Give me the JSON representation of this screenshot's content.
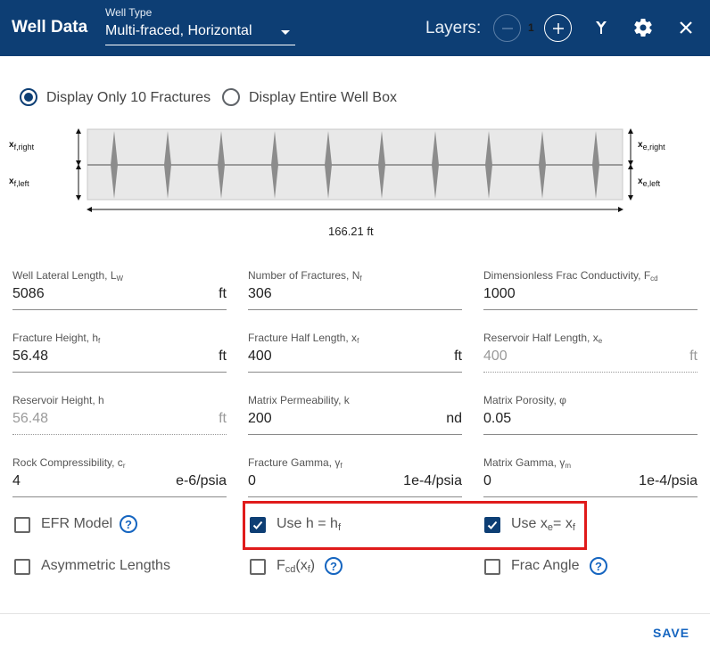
{
  "header": {
    "title": "Well Data",
    "well_type_label": "Well Type",
    "well_type_value": "Multi-fraced, Horizontal",
    "layers_label": "Layers:",
    "layers_count": "1"
  },
  "display_options": {
    "option_10": "Display Only 10 Fractures",
    "option_entire": "Display Entire Well Box",
    "selected": "option_10"
  },
  "diagram": {
    "fracture_count_shown": 10,
    "left_top_main": "x",
    "left_top_sub": "f,right",
    "left_bottom_main": "x",
    "left_bottom_sub": "f,left",
    "right_top_main": "x",
    "right_top_sub": "e,right",
    "right_bottom_main": "x",
    "right_bottom_sub": "e,left",
    "width_label": "166.21 ft"
  },
  "fields": {
    "lateral_length": {
      "label": "Well Lateral Length, L",
      "label_sub": "W",
      "value": "5086",
      "unit": "ft"
    },
    "num_fractures": {
      "label": "Number of Fractures, N",
      "label_sub": "f",
      "value": "306",
      "unit": ""
    },
    "frac_conductivity": {
      "label": "Dimensionless Frac Conductivity, F",
      "label_sub": "cd",
      "value": "1000",
      "unit": ""
    },
    "fracture_height": {
      "label": "Fracture Height, h",
      "label_sub": "f",
      "value": "56.48",
      "unit": "ft"
    },
    "fracture_half_length": {
      "label": "Fracture Half Length, x",
      "label_sub": "f",
      "value": "400",
      "unit": "ft"
    },
    "reservoir_half_length": {
      "label": "Reservoir Half Length, x",
      "label_sub": "e",
      "value": "400",
      "unit": "ft"
    },
    "reservoir_height": {
      "label": "Reservoir Height, h",
      "label_sub": "",
      "value": "56.48",
      "unit": "ft"
    },
    "matrix_permeability": {
      "label": "Matrix Permeability, k",
      "label_sub": "",
      "value": "200",
      "unit": "nd"
    },
    "matrix_porosity": {
      "label": "Matrix Porosity, φ",
      "label_sub": "",
      "value": "0.05",
      "unit": ""
    },
    "rock_compressibility": {
      "label": "Rock Compressibility, c",
      "label_sub": "r",
      "value": "4",
      "unit": "e-6/psia"
    },
    "fracture_gamma": {
      "label": "Fracture Gamma, γ",
      "label_sub": "f",
      "value": "0",
      "unit": "1e-4/psia"
    },
    "matrix_gamma": {
      "label": "Matrix Gamma, γ",
      "label_sub": "m",
      "value": "0",
      "unit": "1e-4/psia"
    }
  },
  "checkboxes": {
    "efr_model": {
      "label": "EFR Model",
      "checked": false
    },
    "use_h": {
      "label": "Use h = h",
      "label_sub": "f",
      "checked": true
    },
    "use_xe": {
      "label_a": "Use x",
      "label_sub_a": "e",
      "label_b": "= x",
      "label_sub_b": "f",
      "checked": true
    },
    "asymmetric": {
      "label": "Asymmetric Lengths",
      "checked": false
    },
    "fcd_xf": {
      "label_a": "F",
      "label_sub_a": "cd",
      "label_b": "(x",
      "label_sub_b": "f",
      "label_c": ")",
      "checked": false
    },
    "frac_angle": {
      "label": "Frac Angle",
      "checked": false
    }
  },
  "help_glyph": "?",
  "footer": {
    "save_label": "SAVE"
  },
  "colors": {
    "header_bg": "#0d3e74",
    "accent": "#1565c0",
    "highlight": "#e01b1b"
  }
}
